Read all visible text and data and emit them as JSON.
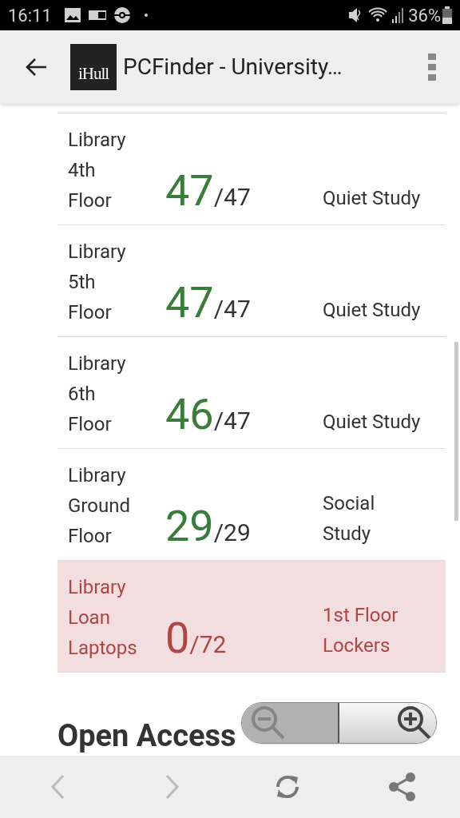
{
  "status_bar": {
    "time": "16:11",
    "battery": "36%"
  },
  "app_bar": {
    "logo": "iHull",
    "title": "PCFinder - University…"
  },
  "rooms": [
    {
      "name": "Library\n4th\nFloor",
      "available": "47",
      "total": "/47",
      "type": "Quiet Study",
      "full": false
    },
    {
      "name": "Library\n5th\nFloor",
      "available": "47",
      "total": "/47",
      "type": "Quiet Study",
      "full": false
    },
    {
      "name": "Library\n6th\nFloor",
      "available": "46",
      "total": "/47",
      "type": "Quiet Study",
      "full": false
    },
    {
      "name": "Library\nGround\nFloor",
      "available": "29",
      "total": "/29",
      "type": "Social\nStudy",
      "full": false
    },
    {
      "name": "Library\nLoan\nLaptops",
      "available": "0",
      "total": "/72",
      "type": "1st Floor\nLockers",
      "full": true
    }
  ],
  "section_heading": "Open Access",
  "zoom_controls": {
    "zoom_out_disabled": true
  },
  "bottom_bar": {
    "back_disabled": true,
    "forward_disabled": true
  }
}
